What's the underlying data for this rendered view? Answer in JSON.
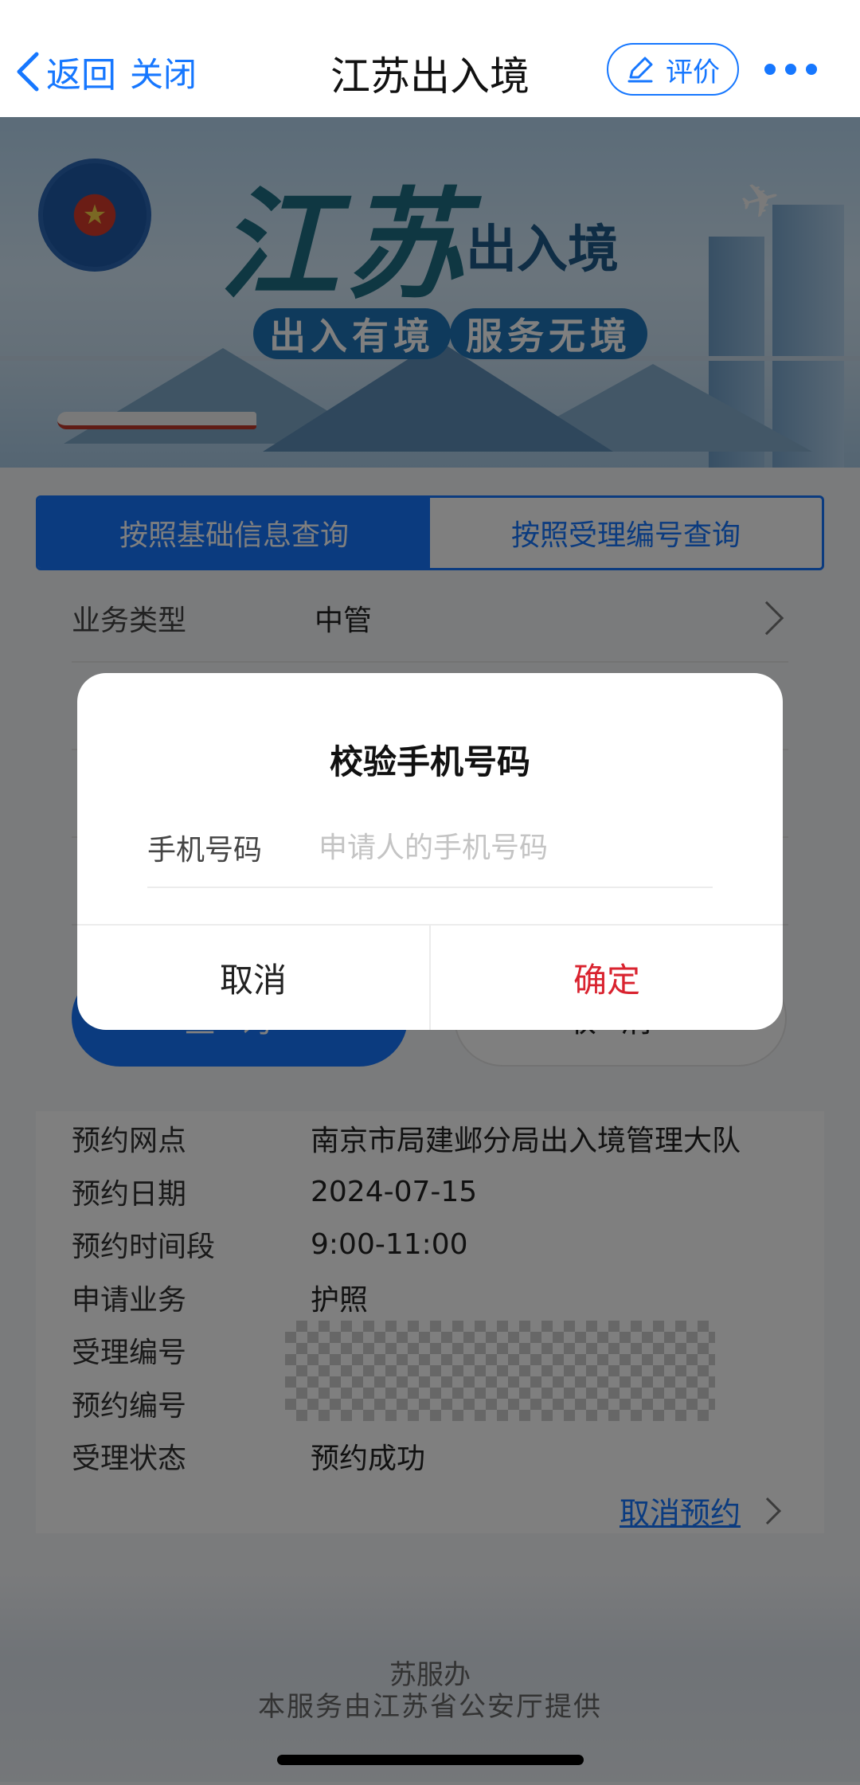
{
  "nav": {
    "back_label": "返回",
    "close_label": "关闭",
    "title": "江苏出入境",
    "rate_label": "评价"
  },
  "banner": {
    "title_main": "江苏",
    "title_sub": "出入境",
    "slogan_left": "出入有境",
    "slogan_right": "服务无境"
  },
  "tabs": [
    {
      "label": "按照基础信息查询",
      "active": true
    },
    {
      "label": "按照受理编号查询",
      "active": false
    }
  ],
  "form": {
    "business_type_label": "业务类型",
    "business_type_value": "中管"
  },
  "buttons": {
    "query": "查询",
    "cancel": "取消"
  },
  "result": {
    "rows": [
      {
        "label": "预约网点",
        "value": "南京市局建邺分局出入境管理大队"
      },
      {
        "label": "预约日期",
        "value": "2024-07-15"
      },
      {
        "label": "预约时间段",
        "value": "9:00-11:00"
      },
      {
        "label": "申请业务",
        "value": "护照"
      },
      {
        "label": "受理编号",
        "value": ""
      },
      {
        "label": "预约编号",
        "value": ""
      },
      {
        "label": "受理状态",
        "value": "预约成功"
      }
    ],
    "cancel_appointment": "取消预约"
  },
  "footer": {
    "line1": "苏服办",
    "line2": "本服务由江苏省公安厅提供"
  },
  "dialog": {
    "title": "校验手机号码",
    "field_label": "手机号码",
    "field_placeholder": "申请人的手机号码",
    "field_value": "",
    "cancel_label": "取消",
    "confirm_label": "确定"
  },
  "colors": {
    "accent": "#1677ff",
    "confirm": "#d9232f"
  }
}
